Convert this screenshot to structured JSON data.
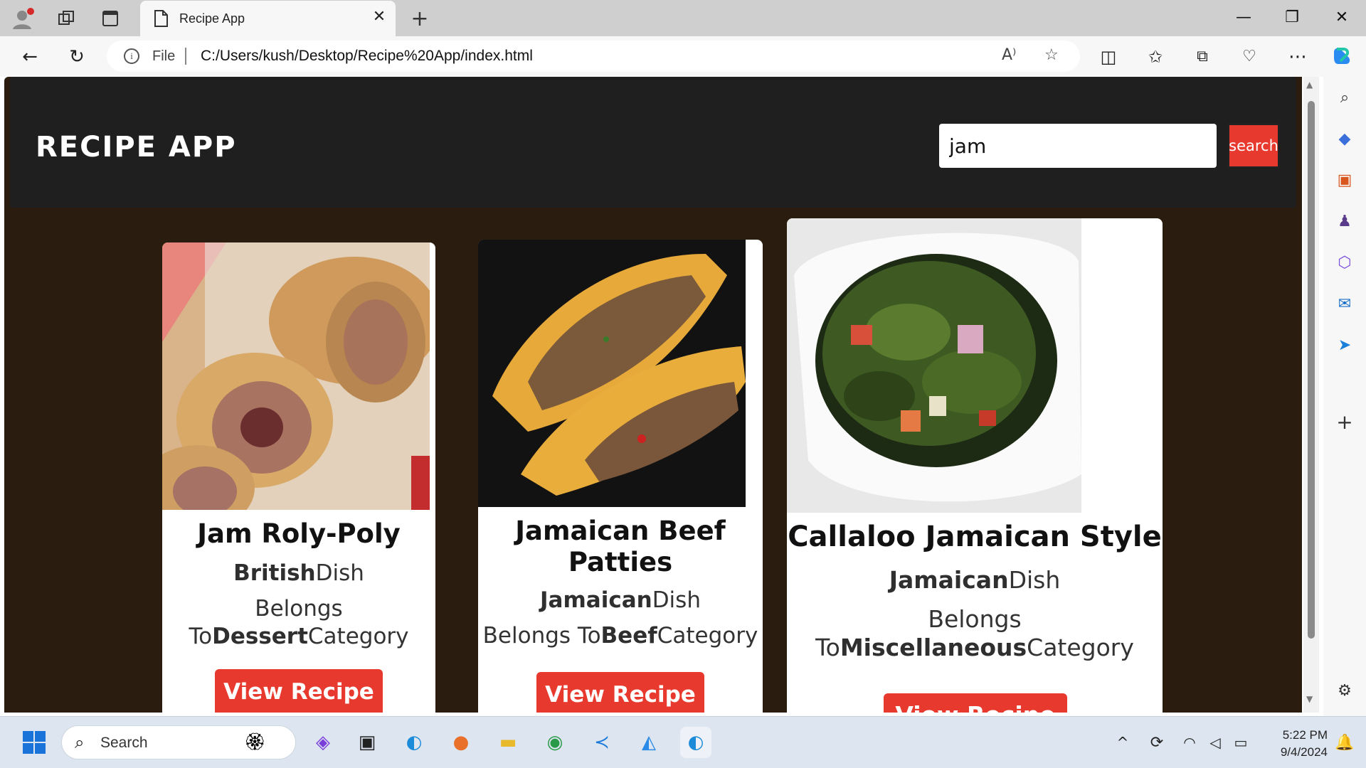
{
  "browser": {
    "tab_title": "Recipe App",
    "file_label": "File",
    "url": "C:/Users/kush/Desktop/Recipe%20App/index.html"
  },
  "app": {
    "title": "RECIPE APP",
    "search_value": "jam",
    "search_button": "search"
  },
  "recipes": [
    {
      "name": "Jam Roly-Poly",
      "area": "British",
      "area_suffix": "Dish",
      "category_prefix": "Belongs To",
      "category": "Dessert",
      "category_suffix": "Category",
      "button": "View Recipe"
    },
    {
      "name": "Jamaican Beef Patties",
      "area": "Jamaican",
      "area_suffix": "Dish",
      "category_prefix": "Belongs To",
      "category": "Beef",
      "category_suffix": "Category",
      "button": "View Recipe"
    },
    {
      "name": "Callaloo Jamaican Style",
      "area": "Jamaican",
      "area_suffix": "Dish",
      "category_prefix": "Belongs To",
      "category": "Miscellaneous",
      "category_suffix": "Category",
      "button": "View Recipe"
    }
  ],
  "taskbar": {
    "search_label": "Search",
    "time": "5:22 PM",
    "date": "9/4/2024"
  },
  "colors": {
    "accent": "#e8392e",
    "page_bg": "#2a1c0e",
    "header_bg": "#1f1f1f"
  }
}
